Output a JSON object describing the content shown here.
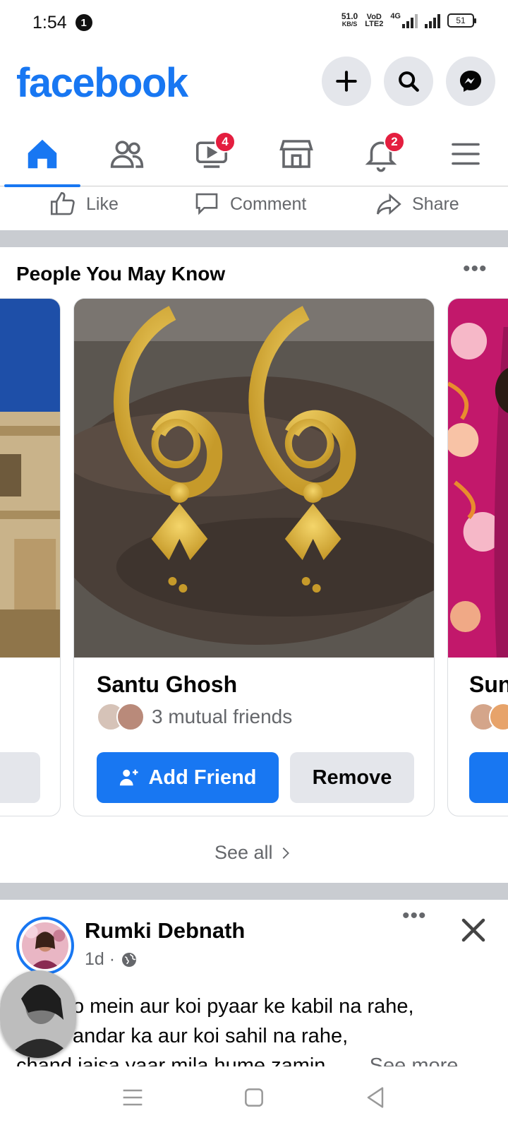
{
  "status": {
    "time": "1:54",
    "notif_count": "1",
    "speed_value": "51.0",
    "speed_unit": "KB/S",
    "vo_top": "VoD",
    "vo_bottom": "LTE2",
    "network": "4G",
    "battery": "51"
  },
  "header": {
    "logo": "facebook"
  },
  "tabs": {
    "watch_badge": "4",
    "notif_badge": "2"
  },
  "actions": {
    "like": "Like",
    "comment": "Comment",
    "share": "Share"
  },
  "pymk": {
    "title": "People You May Know",
    "cards": [
      {
        "name": "Santu Ghosh",
        "mutual": "3 mutual friends",
        "add_label": "Add Friend",
        "remove_label": "Remove"
      },
      {
        "name": "Sun"
      }
    ],
    "see_all": "See all"
  },
  "post": {
    "author": "Rumki Debnath",
    "time": "1d ·",
    "text_lines": [
      "o mein aur koi pyaar ke kabil na rahe,",
      "andar ka aur koi sahil na rahe,",
      "chand jaisa yaar mila hume zamin..."
    ],
    "see_more": "See more"
  },
  "colors": {
    "brand": "#1877f2",
    "badge": "#e41e3f",
    "divider": "#c9ccd1"
  }
}
